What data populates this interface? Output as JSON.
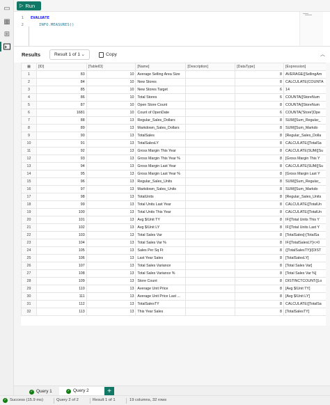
{
  "toolbar": {
    "run_label": "Run"
  },
  "editor": {
    "lines": [
      {
        "num": "1",
        "keyword": "EVALUATE",
        "code": ""
      },
      {
        "num": "2",
        "keyword": "",
        "code": "INFO.MEASURES()"
      }
    ]
  },
  "results": {
    "title": "Results",
    "result_select": "Result 1 of 1",
    "copy_label": "Copy",
    "columns": [
      "[ID]",
      "[TableID]",
      "[Name]",
      "[Description]",
      "[DataType]",
      "[Expression]"
    ],
    "rows": [
      [
        "1",
        "83",
        "10",
        "Average Selling Area Size",
        "",
        "8",
        "AVERAGE([SellingAm"
      ],
      [
        "2",
        "84",
        "10",
        "New Stores",
        "",
        "8",
        "CALCULATE(COUNTA"
      ],
      [
        "3",
        "85",
        "10",
        "New Stores Target",
        "",
        "6",
        "14"
      ],
      [
        "4",
        "86",
        "10",
        "Total Stores",
        "",
        "6",
        "COUNTA([StoreNum"
      ],
      [
        "5",
        "87",
        "10",
        "Open Store Count",
        "",
        "8",
        "COUNTA([StoreNum"
      ],
      [
        "6",
        "1681",
        "10",
        "Count of OpenDate",
        "",
        "6",
        "COUNTA('Store'[Ope"
      ],
      [
        "7",
        "88",
        "13",
        "Regular_Sales_Dollars",
        "",
        "8",
        "SUM([Sum_Regular_"
      ],
      [
        "8",
        "89",
        "13",
        "Markdown_Sales_Dollars",
        "",
        "8",
        "SUM([Sum_Markdo"
      ],
      [
        "9",
        "90",
        "13",
        "TotalSales",
        "",
        "8",
        "[Regular_Sales_Dolla"
      ],
      [
        "10",
        "91",
        "13",
        "TotalSalesLY",
        "",
        "8",
        "CALCULATE([TotalSa"
      ],
      [
        "11",
        "92",
        "13",
        "Gross Margin This Year",
        "",
        "8",
        "CALCULATE(SUM([Su"
      ],
      [
        "12",
        "93",
        "13",
        "Gross Margin This Year %",
        "",
        "8",
        "[Gross Margin This Y"
      ],
      [
        "13",
        "94",
        "13",
        "Gross Margin Last Year",
        "",
        "8",
        "CALCULATE(SUM([Su"
      ],
      [
        "14",
        "95",
        "13",
        "Gross Margin Last Year %",
        "",
        "8",
        "[Gross Margin Last Y"
      ],
      [
        "15",
        "96",
        "13",
        "Regular_Sales_Units",
        "",
        "8",
        "SUM([Sum_Regular_"
      ],
      [
        "16",
        "97",
        "13",
        "Markdown_Sales_Units",
        "",
        "8",
        "SUM([Sum_Markdo"
      ],
      [
        "17",
        "98",
        "13",
        "TotalUnits",
        "",
        "8",
        "[Regular_Sales_Units"
      ],
      [
        "18",
        "99",
        "13",
        "Total Units Last Year",
        "",
        "8",
        "CALCULATE([TotalUn"
      ],
      [
        "19",
        "100",
        "13",
        "Total Units This Year",
        "",
        "8",
        "CALCULATE([TotalUn"
      ],
      [
        "20",
        "101",
        "13",
        "Avg $/Unit TY",
        "",
        "8",
        "IF([Total Units This Y"
      ],
      [
        "21",
        "102",
        "13",
        "Avg $/Unit LY",
        "",
        "8",
        "IF([Total Units Last Y"
      ],
      [
        "22",
        "103",
        "13",
        "Total Sales Var",
        "",
        "8",
        "[TotalSales]-[TotalSa"
      ],
      [
        "23",
        "104",
        "13",
        "Total Sales Var %",
        "",
        "8",
        "IF([TotalSalesLY]<>0"
      ],
      [
        "24",
        "105",
        "13",
        "Sales Per Sq Ft",
        "",
        "8",
        "([TotalSalesTY]/(DIST"
      ],
      [
        "25",
        "106",
        "13",
        "Last Year Sales",
        "",
        "8",
        "[TotalSalesLY]"
      ],
      [
        "26",
        "107",
        "13",
        "Total Sales Variance",
        "",
        "8",
        "[Total Sales Var]"
      ],
      [
        "27",
        "108",
        "13",
        "Total Sales Variance %",
        "",
        "8",
        "[Total Sales Var %]"
      ],
      [
        "28",
        "109",
        "13",
        "Store Count",
        "",
        "8",
        "DISTINCTCOUNT([Lo"
      ],
      [
        "29",
        "110",
        "13",
        "Average Unit Price",
        "",
        "8",
        "[Avg $/Unit TY]"
      ],
      [
        "30",
        "111",
        "13",
        "Average Unit Price Last ...",
        "",
        "8",
        "[Avg $/Unit LY]"
      ],
      [
        "31",
        "112",
        "13",
        "TotalSalesTY",
        "",
        "8",
        "CALCULATE([TotalSa"
      ],
      [
        "32",
        "113",
        "13",
        "This Year Sales",
        "",
        "8",
        "[TotalSalesTY]"
      ]
    ]
  },
  "tabs": [
    {
      "label": "Query 1"
    },
    {
      "label": "Query 2"
    }
  ],
  "add_tab_label": "+",
  "status": {
    "success": "Success (15.9 ms)",
    "query": "Query 2 of 2",
    "result": "Result 1 of 1",
    "summary": "19 columns, 32 rows"
  },
  "colors": {
    "accent": "#117865",
    "success": "#107c10"
  }
}
